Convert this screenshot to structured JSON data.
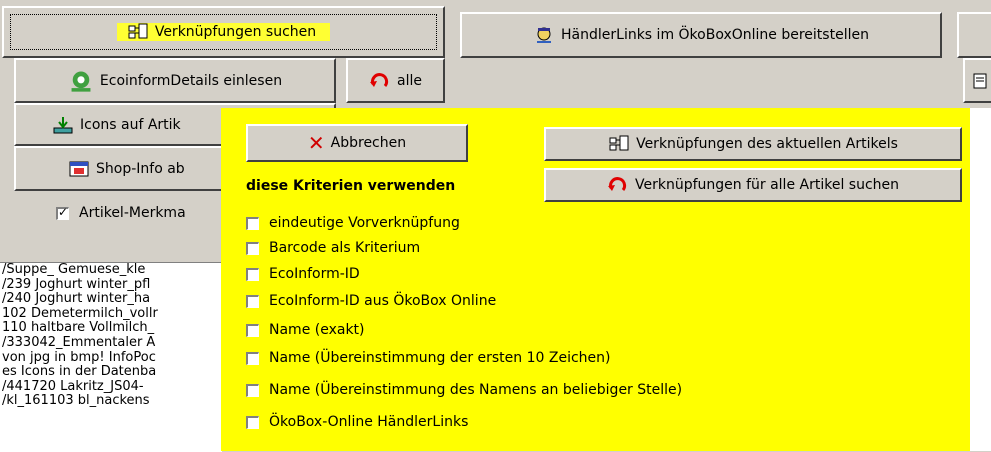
{
  "toolbar": {
    "search_links": "Verknüpfungen suchen",
    "dealer_links": "HändlerLinks im ÖkoBoxOnline bereitstellen",
    "ecoinform_details": "EcoinformDetails einlesen",
    "alle": "alle",
    "icons_label": "Icons auf Artik",
    "shop_info": "Shop-Info ab",
    "merkmal_label": "Artikel-Merkma"
  },
  "log_lines": [
    "/Suppe_ Gemuese_kle",
    "/239 Joghurt winter_pfl",
    "/240 Joghurt winter_ha",
    "102 Demetermilch_vollr",
    "110 haltbare Vollmilch_",
    "/333042_Emmentaler A",
    "von jpg in bmp! InfoPoc",
    "es Icons in der Datenba",
    "/441720 Lakritz_JS04-",
    "/kl_161103 bl_nackens"
  ],
  "popup": {
    "cancel": "Abbrechen",
    "current_article": "Verknüpfungen des aktuellen Artikels",
    "all_articles": "Verknüpfungen für alle Artikel suchen",
    "criteria_heading": "diese Kriterien verwenden",
    "criteria": [
      "eindeutige Vorverknüpfung",
      "Barcode als Kriterium",
      "EcoInform-ID",
      "EcoInform-ID aus ÖkoBox Online",
      "Name (exakt)",
      "Name  (Übereinstimmung der ersten 10 Zeichen)",
      "Name (Übereinstimmung des Namens an beliebiger Stelle)",
      "ÖkoBox-Online HändlerLinks"
    ]
  },
  "colors": {
    "popup_bg": "#ffff00",
    "highlight": "#ffff33",
    "face": "#d4d0c8"
  },
  "icons": [
    "links-icon",
    "dealer-icon",
    "ecoinform-logo-icon",
    "refresh-red-icon",
    "download-icon",
    "shop-info-icon",
    "cancel-x-icon",
    "document-icon"
  ]
}
